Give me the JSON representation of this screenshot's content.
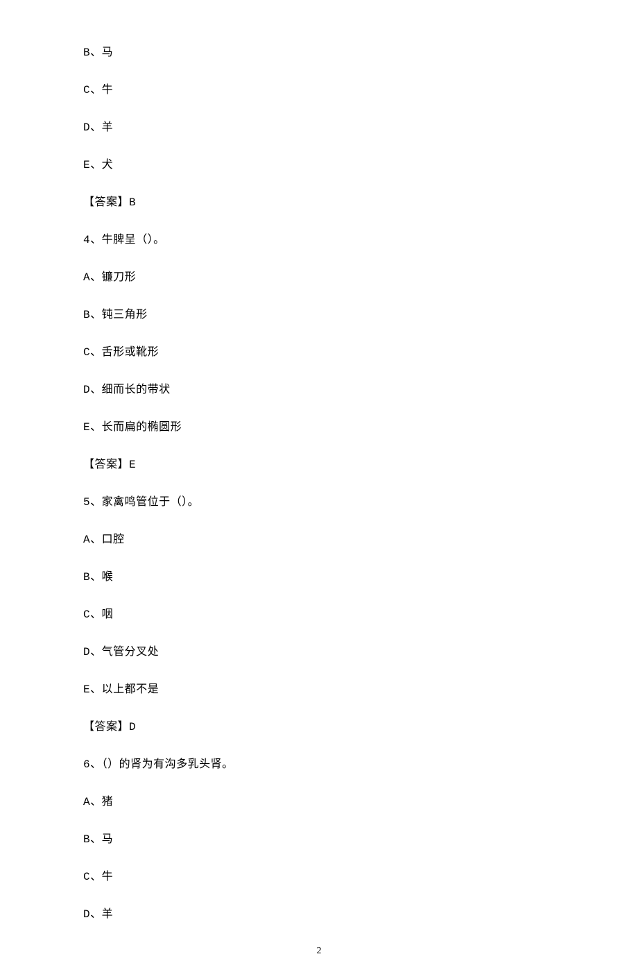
{
  "lines": [
    "B、马",
    "C、牛",
    "D、羊",
    "E、犬",
    "【答案】B",
    "4、牛脾呈（）。",
    "A、镰刀形",
    "B、钝三角形",
    "C、舌形或靴形",
    "D、细而长的带状",
    "E、长而扁的椭圆形",
    "【答案】E",
    "5、家禽鸣管位于（）。",
    "A、口腔",
    "B、喉",
    "C、咽",
    "D、气管分叉处",
    "E、以上都不是",
    "【答案】D",
    "6、（）的肾为有沟多乳头肾。",
    "A、猪",
    "B、马",
    "C、牛",
    "D、羊"
  ],
  "pageNumber": "2"
}
